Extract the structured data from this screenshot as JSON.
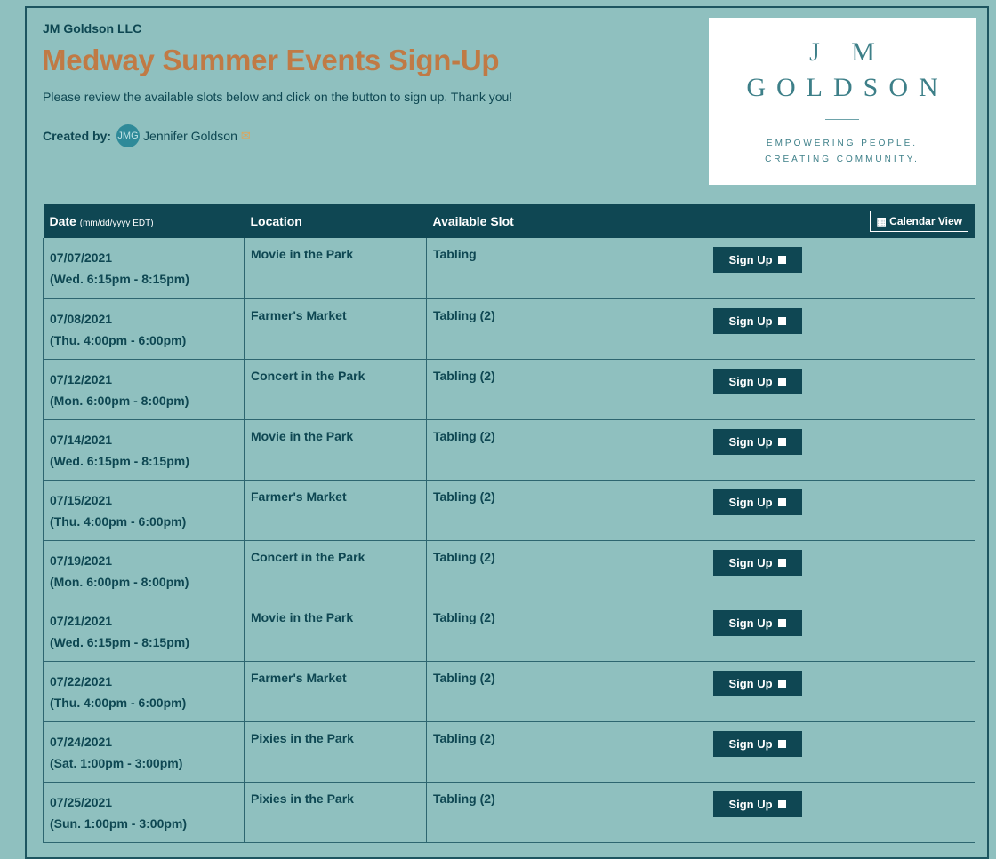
{
  "header": {
    "org": "JM Goldson LLC",
    "title": "Medway Summer Events Sign-Up",
    "description": "Please review the available slots below and click on the button to sign up. Thank you!",
    "created_by_label": "Created by:",
    "creator_name": "Jennifer Goldson",
    "creator_initials": "JMG"
  },
  "logo": {
    "line1": "J M",
    "line2": "GOLDSON",
    "tagline1": "EMPOWERING PEOPLE.",
    "tagline2": "CREATING COMMUNITY."
  },
  "table": {
    "col_date": "Date",
    "col_date_hint": "(mm/dd/yyyy EDT)",
    "col_location": "Location",
    "col_slot": "Available Slot",
    "calendar_view": "Calendar View",
    "signup_label": "Sign Up",
    "rows": [
      {
        "date": "07/07/2021",
        "time": "(Wed. 6:15pm - 8:15pm)",
        "location": "Movie in the Park",
        "slot": "Tabling"
      },
      {
        "date": "07/08/2021",
        "time": "(Thu. 4:00pm - 6:00pm)",
        "location": "Farmer's Market",
        "slot": "Tabling (2)"
      },
      {
        "date": "07/12/2021",
        "time": "(Mon. 6:00pm - 8:00pm)",
        "location": "Concert in the Park",
        "slot": "Tabling (2)"
      },
      {
        "date": "07/14/2021",
        "time": "(Wed. 6:15pm - 8:15pm)",
        "location": "Movie in the Park",
        "slot": "Tabling (2)"
      },
      {
        "date": "07/15/2021",
        "time": "(Thu. 4:00pm - 6:00pm)",
        "location": "Farmer's Market",
        "slot": "Tabling (2)"
      },
      {
        "date": "07/19/2021",
        "time": "(Mon. 6:00pm - 8:00pm)",
        "location": "Concert in the Park",
        "slot": "Tabling (2)"
      },
      {
        "date": "07/21/2021",
        "time": "(Wed. 6:15pm - 8:15pm)",
        "location": "Movie in the Park",
        "slot": "Tabling (2)"
      },
      {
        "date": "07/22/2021",
        "time": "(Thu. 4:00pm - 6:00pm)",
        "location": "Farmer's Market",
        "slot": "Tabling (2)"
      },
      {
        "date": "07/24/2021",
        "time": "(Sat. 1:00pm - 3:00pm)",
        "location": "Pixies in the Park",
        "slot": "Tabling (2)"
      },
      {
        "date": "07/25/2021",
        "time": "(Sun. 1:00pm - 3:00pm)",
        "location": "Pixies in the Park",
        "slot": "Tabling (2)"
      }
    ]
  },
  "colors": {
    "background": "#8fc0bf",
    "header_bg": "#0f4753",
    "title": "#c07a45",
    "text": "#0e4752"
  },
  "icons": {
    "calendar": "calendar-icon",
    "mail": "mail-icon",
    "checkbox": "checkbox-icon"
  }
}
